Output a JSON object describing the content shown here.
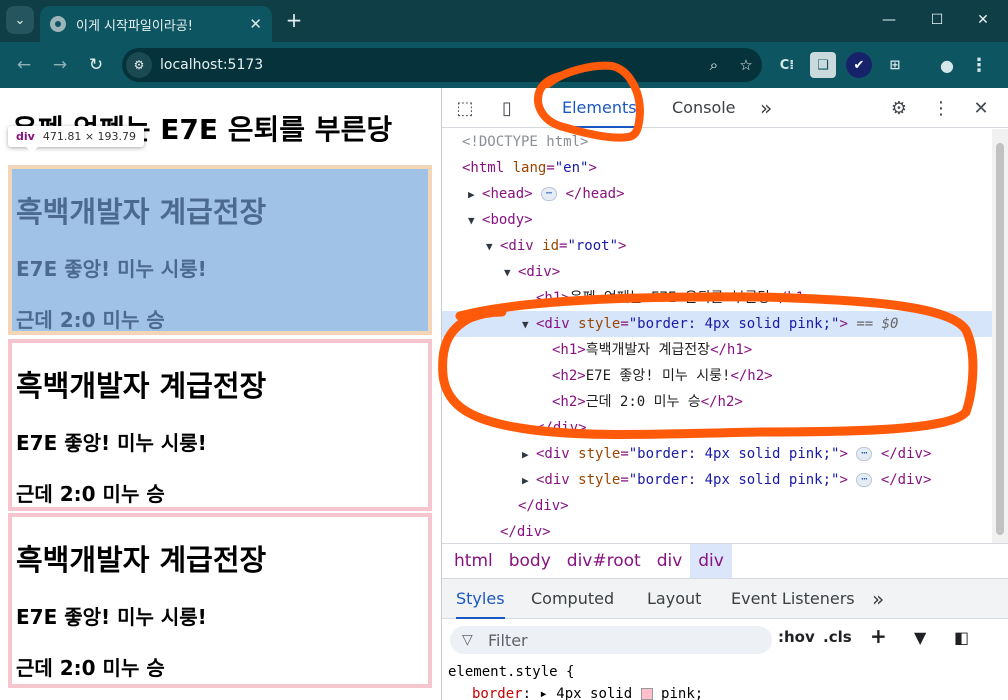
{
  "browser": {
    "tab_title": "이게 시작파일이라공!",
    "url": "localhost:5173",
    "tab_menu_icon": "chevron-down-icon",
    "new_tab_symbol": "+",
    "close_symbol": "✕",
    "win_minimize": "—",
    "win_maximize": "☐",
    "win_close": "✕",
    "extensions": [
      "C⁞",
      "❑",
      "✔",
      "⊞"
    ]
  },
  "page": {
    "heading": "은폐 엄폐는 E7E 은퇴를 부른당",
    "tooltip": {
      "tag": "div",
      "size": "471.81 × 193.79"
    },
    "cards": [
      {
        "title": "흑백개발자 계급전장",
        "line1": "E7E 좋앙! 미누 시룽!",
        "line2": "근데 2:0 미누 승"
      },
      {
        "title": "흑백개발자 계급전장",
        "line1": "E7E 좋앙! 미누 시룽!",
        "line2": "근데 2:0 미누 승"
      },
      {
        "title": "흑백개발자 계급전장",
        "line1": "E7E 좋앙! 미누 시룽!",
        "line2": "근데 2:0 미누 승"
      }
    ]
  },
  "devtools": {
    "tabs": [
      "Elements",
      "Console"
    ],
    "more_tabs": "»",
    "dom": {
      "doctype": "<!DOCTYPE html>",
      "html_open_tag": "<html",
      "lang_attr": "lang",
      "lang_value": "\"en\"",
      "head": "head",
      "body": "body",
      "root_id_attr": "id",
      "root_id_value": "\"root\"",
      "h1_text": "은폐 엄폐는 E7E 은퇴를 부른당",
      "div_style_attr": "style",
      "div_style_value": "\"border: 4px solid pink;\"",
      "selected_marker": "== $0",
      "child_h1": "흑백개발자 계급전장",
      "child_h2_1": "E7E 좋앙! 미누 시룽!",
      "child_h2_2": "근데 2:0 미누 승",
      "ellipsis": "⋯"
    },
    "breadcrumbs": [
      "html",
      "body",
      "div#root",
      "div",
      "div"
    ],
    "sub_tabs": [
      "Styles",
      "Computed",
      "Layout",
      "Event Listeners"
    ],
    "filter_placeholder": "Filter",
    "hov_label": ":hov",
    "cls_label": ".cls",
    "styles": {
      "selector": "element.style {",
      "prop": "border",
      "value": "4px solid",
      "color_name": "pink;"
    },
    "annotation_color": "#ff5a0a"
  }
}
